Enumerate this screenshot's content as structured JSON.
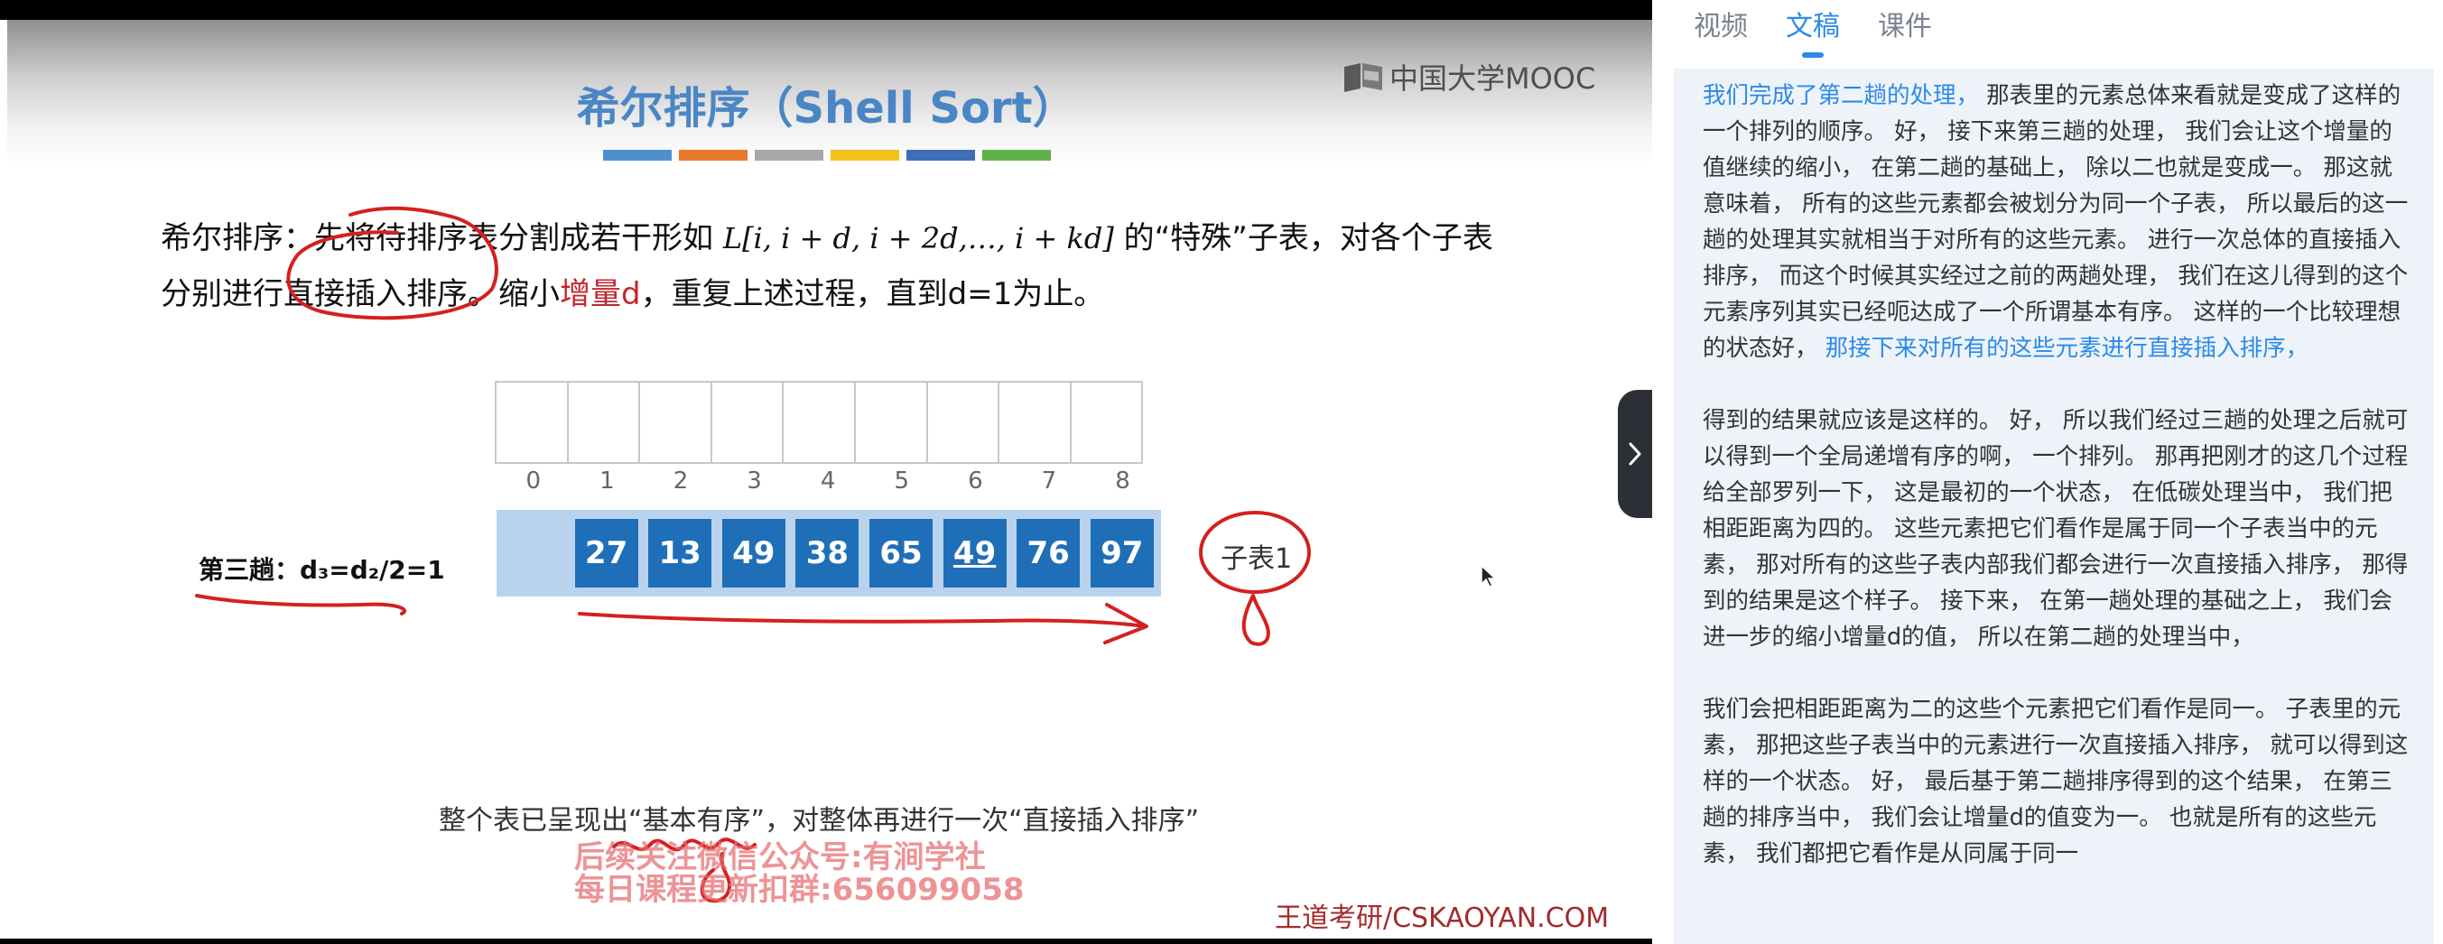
{
  "panel": {
    "tabs": [
      {
        "label": "视频",
        "active": false
      },
      {
        "label": "文稿",
        "active": true
      },
      {
        "label": "课件",
        "active": false
      }
    ],
    "paragraphs": [
      {
        "segments": [
          {
            "text": "我们完成了第二趟的处理，",
            "highlight": true
          },
          {
            "text": " 那表里的元素总体来看就是变成了这样的一个排列的顺序。 好， 接下来第三趟的处理， 我们会让这个增量的值继续的缩小， 在第二趟的基础上， 除以二也就是变成一。 那这就意味着， 所有的这些元素都会被划分为同一个子表， 所以最后的这一趟的处理其实就相当于对所有的这些元素。 进行一次总体的直接插入排序， 而这个时候其实经过之前的两趟处理， 我们在这儿得到的这个元素序列其实已经呃达成了一个所谓基本有序。 这样的一个比较理想的状态好， ",
            "highlight": false
          },
          {
            "text": "那接下来对所有的这些元素进行直接插入排序，",
            "highlight": true
          }
        ]
      },
      {
        "segments": [
          {
            "text": "得到的结果就应该是这样的。 好， 所以我们经过三趟的处理之后就可以得到一个全局递增有序的啊， 一个排列。 那再把刚才的这几个过程给全部罗列一下， 这是最初的一个状态， 在低碳处理当中， 我们把相距距离为四的。 这些元素把它们看作是属于同一个子表当中的元素， 那对所有的这些子表内部我们都会进行一次直接插入排序， 那得到的结果是这个样子。 接下来， 在第一趟处理的基础之上， 我们会进一步的缩小增量d的值， 所以在第二趟的处理当中，",
            "highlight": false
          }
        ]
      },
      {
        "segments": [
          {
            "text": "我们会把相距距离为二的这些个元素把它们看作是同一。 子表里的元素， 那把这些子表当中的元素进行一次直接插入排序， 就可以得到这样的一个状态。 好， 最后基于第二趟排序得到的这个结果， 在第三趟的排序当中， 我们会让增量d的值变为一。 也就是所有的这些元素， 我们都把它看作是从同属于同一",
            "highlight": false
          }
        ]
      }
    ]
  },
  "slide": {
    "logo_text": "中国大学MOOC",
    "title": "希尔排序（Shell Sort）",
    "title_bar_colors": [
      "#4f8fd0",
      "#e8782c",
      "#a8a8a8",
      "#f2c21a",
      "#3f6fb6",
      "#5fb14a"
    ],
    "definition": {
      "line1_pre": "希尔排序：先将待排序表分割成若干形如 ",
      "math": "L[i, i + d, i + 2d,…, i + kd]",
      "line1_post": " 的“特殊”子表，对各个子表",
      "line2_pre": "分别进行直接插入排序。缩小",
      "line2_accent": "增量d",
      "line2_post": "，重复上述过程，直到d=1为止。"
    },
    "indices": [
      "0",
      "1",
      "2",
      "3",
      "4",
      "5",
      "6",
      "7",
      "8"
    ],
    "values": [
      "27",
      "13",
      "49",
      "38",
      "65",
      "49",
      "76",
      "97"
    ],
    "underlined_value_position": 6,
    "pass_label": "第三趟：d₃=d₂/2=1",
    "sublist_label": "子表1",
    "summary": "整个表已呈现出“基本有序”，对整体再进行一次“直接插入排序”",
    "watermark_line1": "后续关注微信公众号:有涧学社",
    "watermark_line2": "每日课程更新扣群:656099058",
    "brand": "王道考研/CSKAOYAN.COM"
  }
}
